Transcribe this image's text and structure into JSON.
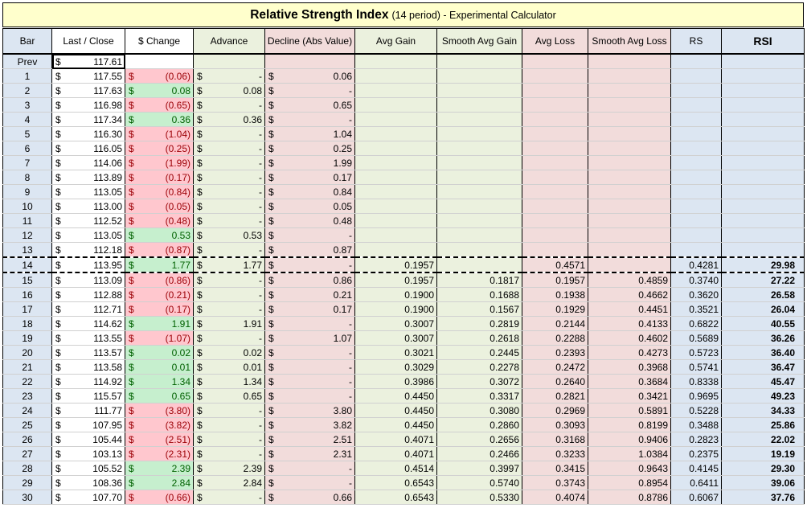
{
  "title": {
    "main": "Relative Strength Index",
    "sub": "(14 period)  -  Experimental Calculator"
  },
  "currency_symbol": "$",
  "headers": [
    "Bar",
    "Last / Close",
    "$ Change",
    "Advance",
    "Decline (Abs Value)",
    "Avg Gain",
    "Smooth Avg Gain",
    "Avg Loss",
    "Smooth Avg Loss",
    "RS",
    "RSI"
  ],
  "colors": {
    "title_bg": "#ffffcc",
    "positive_bg": "#c6efce",
    "positive_text": "#006100",
    "negative_bg": "#ffc7ce",
    "negative_text": "#9c0006",
    "blue_column_bg": "#dce6f2",
    "green_column_bg": "#ebf1de",
    "red_column_bg": "#f2dcdb"
  },
  "rows": [
    {
      "bar": "Prev",
      "close": "117.61",
      "change": "",
      "advance": "",
      "decline": "",
      "avg_gain": "",
      "smooth_avg_gain": "",
      "avg_loss": "",
      "smooth_avg_loss": "",
      "rs": "",
      "rsi": ""
    },
    {
      "bar": "1",
      "close": "117.55",
      "change": "(0.06)",
      "advance": "-",
      "decline": "0.06",
      "avg_gain": "",
      "smooth_avg_gain": "",
      "avg_loss": "",
      "smooth_avg_loss": "",
      "rs": "",
      "rsi": ""
    },
    {
      "bar": "2",
      "close": "117.63",
      "change": "0.08",
      "advance": "0.08",
      "decline": "-",
      "avg_gain": "",
      "smooth_avg_gain": "",
      "avg_loss": "",
      "smooth_avg_loss": "",
      "rs": "",
      "rsi": ""
    },
    {
      "bar": "3",
      "close": "116.98",
      "change": "(0.65)",
      "advance": "-",
      "decline": "0.65",
      "avg_gain": "",
      "smooth_avg_gain": "",
      "avg_loss": "",
      "smooth_avg_loss": "",
      "rs": "",
      "rsi": ""
    },
    {
      "bar": "4",
      "close": "117.34",
      "change": "0.36",
      "advance": "0.36",
      "decline": "-",
      "avg_gain": "",
      "smooth_avg_gain": "",
      "avg_loss": "",
      "smooth_avg_loss": "",
      "rs": "",
      "rsi": ""
    },
    {
      "bar": "5",
      "close": "116.30",
      "change": "(1.04)",
      "advance": "-",
      "decline": "1.04",
      "avg_gain": "",
      "smooth_avg_gain": "",
      "avg_loss": "",
      "smooth_avg_loss": "",
      "rs": "",
      "rsi": ""
    },
    {
      "bar": "6",
      "close": "116.05",
      "change": "(0.25)",
      "advance": "-",
      "decline": "0.25",
      "avg_gain": "",
      "smooth_avg_gain": "",
      "avg_loss": "",
      "smooth_avg_loss": "",
      "rs": "",
      "rsi": ""
    },
    {
      "bar": "7",
      "close": "114.06",
      "change": "(1.99)",
      "advance": "-",
      "decline": "1.99",
      "avg_gain": "",
      "smooth_avg_gain": "",
      "avg_loss": "",
      "smooth_avg_loss": "",
      "rs": "",
      "rsi": ""
    },
    {
      "bar": "8",
      "close": "113.89",
      "change": "(0.17)",
      "advance": "-",
      "decline": "0.17",
      "avg_gain": "",
      "smooth_avg_gain": "",
      "avg_loss": "",
      "smooth_avg_loss": "",
      "rs": "",
      "rsi": ""
    },
    {
      "bar": "9",
      "close": "113.05",
      "change": "(0.84)",
      "advance": "-",
      "decline": "0.84",
      "avg_gain": "",
      "smooth_avg_gain": "",
      "avg_loss": "",
      "smooth_avg_loss": "",
      "rs": "",
      "rsi": ""
    },
    {
      "bar": "10",
      "close": "113.00",
      "change": "(0.05)",
      "advance": "-",
      "decline": "0.05",
      "avg_gain": "",
      "smooth_avg_gain": "",
      "avg_loss": "",
      "smooth_avg_loss": "",
      "rs": "",
      "rsi": ""
    },
    {
      "bar": "11",
      "close": "112.52",
      "change": "(0.48)",
      "advance": "-",
      "decline": "0.48",
      "avg_gain": "",
      "smooth_avg_gain": "",
      "avg_loss": "",
      "smooth_avg_loss": "",
      "rs": "",
      "rsi": ""
    },
    {
      "bar": "12",
      "close": "113.05",
      "change": "0.53",
      "advance": "0.53",
      "decline": "-",
      "avg_gain": "",
      "smooth_avg_gain": "",
      "avg_loss": "",
      "smooth_avg_loss": "",
      "rs": "",
      "rsi": ""
    },
    {
      "bar": "13",
      "close": "112.18",
      "change": "(0.87)",
      "advance": "-",
      "decline": "0.87",
      "avg_gain": "",
      "smooth_avg_gain": "",
      "avg_loss": "",
      "smooth_avg_loss": "",
      "rs": "",
      "rsi": ""
    },
    {
      "bar": "14",
      "close": "113.95",
      "change": "1.77",
      "advance": "1.77",
      "decline": "-",
      "avg_gain": "0.1957",
      "smooth_avg_gain": "",
      "avg_loss": "0.4571",
      "smooth_avg_loss": "",
      "rs": "0.4281",
      "rsi": "29.98"
    },
    {
      "bar": "15",
      "close": "113.09",
      "change": "(0.86)",
      "advance": "-",
      "decline": "0.86",
      "avg_gain": "0.1957",
      "smooth_avg_gain": "0.1817",
      "avg_loss": "0.1957",
      "smooth_avg_loss": "0.4859",
      "rs": "0.3740",
      "rsi": "27.22"
    },
    {
      "bar": "16",
      "close": "112.88",
      "change": "(0.21)",
      "advance": "-",
      "decline": "0.21",
      "avg_gain": "0.1900",
      "smooth_avg_gain": "0.1688",
      "avg_loss": "0.1938",
      "smooth_avg_loss": "0.4662",
      "rs": "0.3620",
      "rsi": "26.58"
    },
    {
      "bar": "17",
      "close": "112.71",
      "change": "(0.17)",
      "advance": "-",
      "decline": "0.17",
      "avg_gain": "0.1900",
      "smooth_avg_gain": "0.1567",
      "avg_loss": "0.1929",
      "smooth_avg_loss": "0.4451",
      "rs": "0.3521",
      "rsi": "26.04"
    },
    {
      "bar": "18",
      "close": "114.62",
      "change": "1.91",
      "advance": "1.91",
      "decline": "-",
      "avg_gain": "0.3007",
      "smooth_avg_gain": "0.2819",
      "avg_loss": "0.2144",
      "smooth_avg_loss": "0.4133",
      "rs": "0.6822",
      "rsi": "40.55"
    },
    {
      "bar": "19",
      "close": "113.55",
      "change": "(1.07)",
      "advance": "-",
      "decline": "1.07",
      "avg_gain": "0.3007",
      "smooth_avg_gain": "0.2618",
      "avg_loss": "0.2288",
      "smooth_avg_loss": "0.4602",
      "rs": "0.5689",
      "rsi": "36.26"
    },
    {
      "bar": "20",
      "close": "113.57",
      "change": "0.02",
      "advance": "0.02",
      "decline": "-",
      "avg_gain": "0.3021",
      "smooth_avg_gain": "0.2445",
      "avg_loss": "0.2393",
      "smooth_avg_loss": "0.4273",
      "rs": "0.5723",
      "rsi": "36.40"
    },
    {
      "bar": "21",
      "close": "113.58",
      "change": "0.01",
      "advance": "0.01",
      "decline": "-",
      "avg_gain": "0.3029",
      "smooth_avg_gain": "0.2278",
      "avg_loss": "0.2472",
      "smooth_avg_loss": "0.3968",
      "rs": "0.5741",
      "rsi": "36.47"
    },
    {
      "bar": "22",
      "close": "114.92",
      "change": "1.34",
      "advance": "1.34",
      "decline": "-",
      "avg_gain": "0.3986",
      "smooth_avg_gain": "0.3072",
      "avg_loss": "0.2640",
      "smooth_avg_loss": "0.3684",
      "rs": "0.8338",
      "rsi": "45.47"
    },
    {
      "bar": "23",
      "close": "115.57",
      "change": "0.65",
      "advance": "0.65",
      "decline": "-",
      "avg_gain": "0.4450",
      "smooth_avg_gain": "0.3317",
      "avg_loss": "0.2821",
      "smooth_avg_loss": "0.3421",
      "rs": "0.9695",
      "rsi": "49.23"
    },
    {
      "bar": "24",
      "close": "111.77",
      "change": "(3.80)",
      "advance": "-",
      "decline": "3.80",
      "avg_gain": "0.4450",
      "smooth_avg_gain": "0.3080",
      "avg_loss": "0.2969",
      "smooth_avg_loss": "0.5891",
      "rs": "0.5228",
      "rsi": "34.33"
    },
    {
      "bar": "25",
      "close": "107.95",
      "change": "(3.82)",
      "advance": "-",
      "decline": "3.82",
      "avg_gain": "0.4450",
      "smooth_avg_gain": "0.2860",
      "avg_loss": "0.3093",
      "smooth_avg_loss": "0.8199",
      "rs": "0.3488",
      "rsi": "25.86"
    },
    {
      "bar": "26",
      "close": "105.44",
      "change": "(2.51)",
      "advance": "-",
      "decline": "2.51",
      "avg_gain": "0.4071",
      "smooth_avg_gain": "0.2656",
      "avg_loss": "0.3168",
      "smooth_avg_loss": "0.9406",
      "rs": "0.2823",
      "rsi": "22.02"
    },
    {
      "bar": "27",
      "close": "103.13",
      "change": "(2.31)",
      "advance": "-",
      "decline": "2.31",
      "avg_gain": "0.4071",
      "smooth_avg_gain": "0.2466",
      "avg_loss": "0.3233",
      "smooth_avg_loss": "1.0384",
      "rs": "0.2375",
      "rsi": "19.19"
    },
    {
      "bar": "28",
      "close": "105.52",
      "change": "2.39",
      "advance": "2.39",
      "decline": "-",
      "avg_gain": "0.4514",
      "smooth_avg_gain": "0.3997",
      "avg_loss": "0.3415",
      "smooth_avg_loss": "0.9643",
      "rs": "0.4145",
      "rsi": "29.30"
    },
    {
      "bar": "29",
      "close": "108.36",
      "change": "2.84",
      "advance": "2.84",
      "decline": "-",
      "avg_gain": "0.6543",
      "smooth_avg_gain": "0.5740",
      "avg_loss": "0.3743",
      "smooth_avg_loss": "0.8954",
      "rs": "0.6411",
      "rsi": "39.06"
    },
    {
      "bar": "30",
      "close": "107.70",
      "change": "(0.66)",
      "advance": "-",
      "decline": "0.66",
      "avg_gain": "0.6543",
      "smooth_avg_gain": "0.5330",
      "avg_loss": "0.4074",
      "smooth_avg_loss": "0.8786",
      "rs": "0.6067",
      "rsi": "37.76"
    }
  ]
}
